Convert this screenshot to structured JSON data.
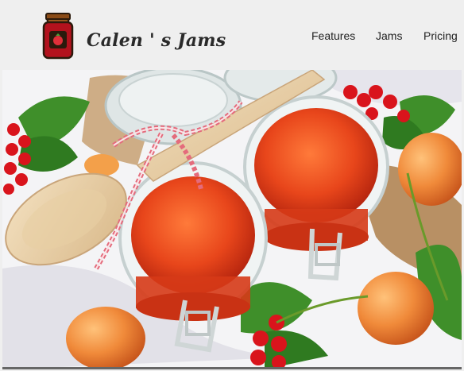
{
  "brand": {
    "name": "Calen ' s Jams",
    "logo_icon": "jam-jar-icon"
  },
  "nav": {
    "items": [
      "Features",
      "Jams",
      "Pricing"
    ]
  },
  "hero": {
    "image": "apricot-jam-jars-photo",
    "colors": {
      "jam": "#e8461b",
      "apricot": "#f08a3a",
      "berries": "#d9141c",
      "leaves": "#3f8f2a",
      "cloth": "#f4f4f6"
    }
  }
}
